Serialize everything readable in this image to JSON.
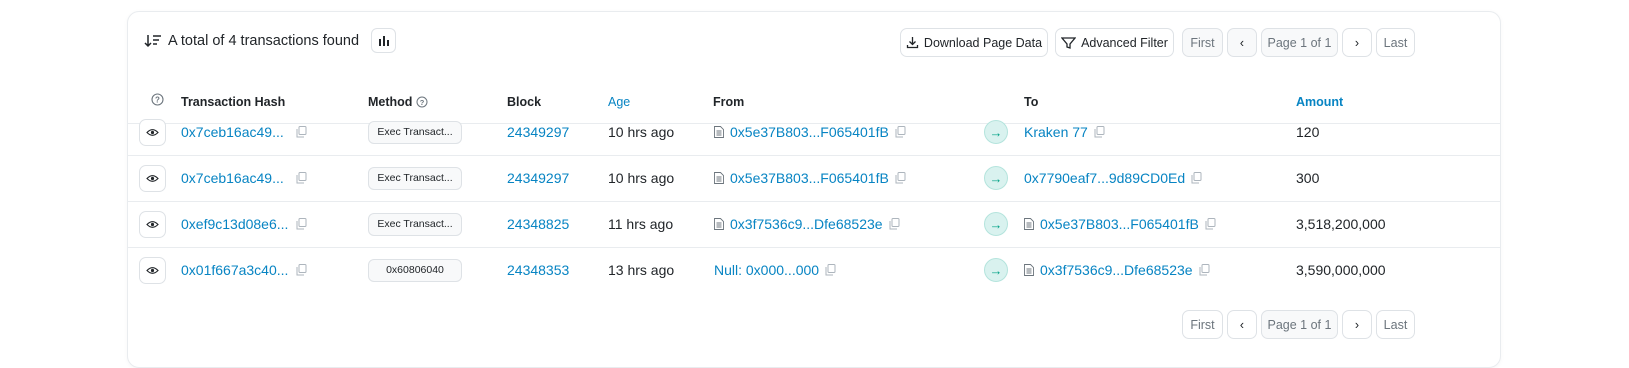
{
  "summary": {
    "text": "A total of 4 transactions found"
  },
  "toolbar": {
    "download_label": "Download Page Data",
    "filter_label": "Advanced Filter"
  },
  "pager": {
    "first": "First",
    "page_info": "Page 1 of 1",
    "last": "Last",
    "prev_icon": "chevron-left-icon",
    "next_icon": "chevron-right-icon"
  },
  "columns": {
    "hash": "Transaction Hash",
    "method": "Method",
    "block": "Block",
    "age": "Age",
    "from": "From",
    "to": "To",
    "amount": "Amount"
  },
  "rows": [
    {
      "hash": "0x7ceb16ac49...",
      "method": "Exec Transact...",
      "block": "24349297",
      "age": "10 hrs ago",
      "from": "0x5e37B803...F065401fB",
      "to": "Kraken 77",
      "amount": "120"
    },
    {
      "hash": "0x7ceb16ac49...",
      "method": "Exec Transact...",
      "block": "24349297",
      "age": "10 hrs ago",
      "from": "0x5e37B803...F065401fB",
      "to": "0x7790eaf7...9d89CD0Ed",
      "amount": "300"
    },
    {
      "hash": "0xef9c13d08e6...",
      "method": "Exec Transact...",
      "block": "24348825",
      "age": "11 hrs ago",
      "from": "0x3f7536c9...Dfe68523e",
      "to": "0x5e37B803...F065401fB",
      "amount": "3,518,200,000"
    },
    {
      "hash": "0x01f667a3c40...",
      "method": "0x60806040",
      "block": "24348353",
      "age": "13 hrs ago",
      "from": "Null: 0x000...000",
      "to": "0x3f7536c9...Dfe68523e",
      "amount": "3,590,000,000"
    }
  ],
  "colors": {
    "link": "#0784c3",
    "arrow_bg": "#d9f2ef",
    "arrow_fg": "#00a186",
    "border": "#dee2e6"
  }
}
